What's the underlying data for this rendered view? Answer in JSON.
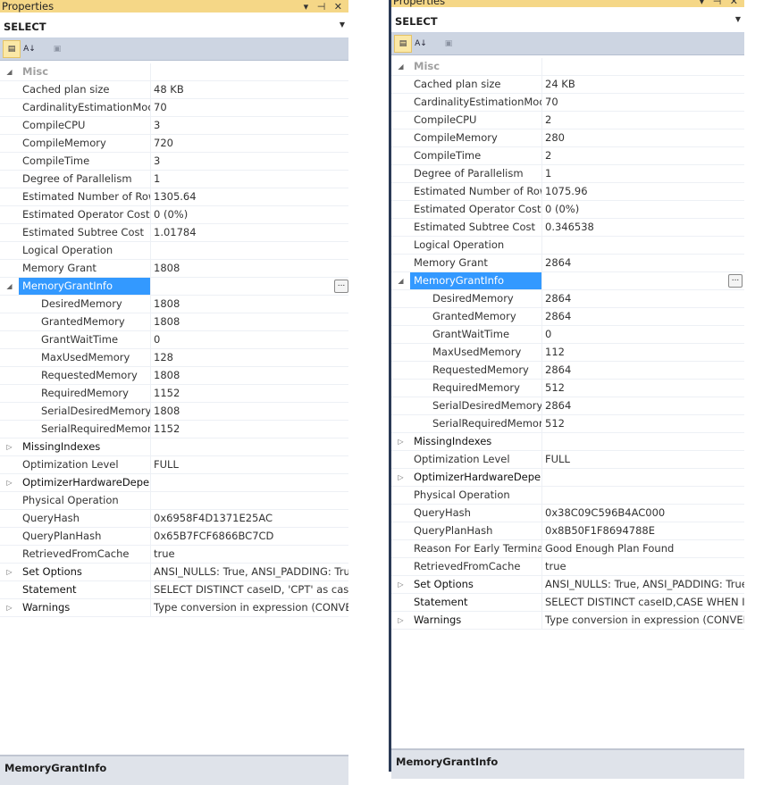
{
  "left": {
    "title": "Properties",
    "title_controls": "▾ ⊣ ✕",
    "selected_object": "SELECT",
    "rows": [
      {
        "name": "Misc",
        "value": "",
        "kind": "category",
        "exp": "◢"
      },
      {
        "name": "Cached plan size",
        "value": "48 KB"
      },
      {
        "name": "CardinalityEstimationModel",
        "value": "70"
      },
      {
        "name": "CompileCPU",
        "value": "3"
      },
      {
        "name": "CompileMemory",
        "value": "720"
      },
      {
        "name": "CompileTime",
        "value": "3"
      },
      {
        "name": "Degree of Parallelism",
        "value": "1"
      },
      {
        "name": "Estimated Number of Rows",
        "value": "1305.64"
      },
      {
        "name": "Estimated Operator Cost",
        "value": "0 (0%)"
      },
      {
        "name": "Estimated Subtree Cost",
        "value": "1.01784"
      },
      {
        "name": "Logical Operation",
        "value": ""
      },
      {
        "name": "Memory Grant",
        "value": "1808"
      },
      {
        "name": "MemoryGrantInfo",
        "value": "",
        "kind": "selected",
        "exp": "◢",
        "ellipsis": "..."
      },
      {
        "name": "DesiredMemory",
        "value": "1808",
        "kind": "sub"
      },
      {
        "name": "GrantedMemory",
        "value": "1808",
        "kind": "sub"
      },
      {
        "name": "GrantWaitTime",
        "value": "0",
        "kind": "sub"
      },
      {
        "name": "MaxUsedMemory",
        "value": "128",
        "kind": "sub"
      },
      {
        "name": "RequestedMemory",
        "value": "1808",
        "kind": "sub"
      },
      {
        "name": "RequiredMemory",
        "value": "1152",
        "kind": "sub"
      },
      {
        "name": "SerialDesiredMemory",
        "value": "1808",
        "kind": "sub"
      },
      {
        "name": "SerialRequiredMemory",
        "value": "1152",
        "kind": "sub"
      },
      {
        "name": "MissingIndexes",
        "value": "",
        "kind": "bold",
        "exp": "▷"
      },
      {
        "name": "Optimization Level",
        "value": "FULL"
      },
      {
        "name": "OptimizerHardwareDependentProperties",
        "value": "",
        "kind": "bold",
        "exp": "▷"
      },
      {
        "name": "Physical Operation",
        "value": ""
      },
      {
        "name": "QueryHash",
        "value": "0x6958F4D1371E25AC"
      },
      {
        "name": "QueryPlanHash",
        "value": "0x65B7FCF6866BC7CD"
      },
      {
        "name": "RetrievedFromCache",
        "value": "true"
      },
      {
        "name": "Set Options",
        "value": "ANSI_NULLS: True, ANSI_PADDING: True, ANSI_WARNINGS: True",
        "kind": "bold",
        "exp": "▷"
      },
      {
        "name": "Statement",
        "value": "SELECT DISTINCT caseID, 'CPT' as caseC,",
        "kind": "bold"
      },
      {
        "name": "Warnings",
        "value": "Type conversion in expression (CONVERT_IMPLICIT",
        "kind": "bold",
        "exp": "▷"
      }
    ],
    "status": "MemoryGrantInfo"
  },
  "right": {
    "title": "Properties",
    "title_controls": "▾ ⊣ ✕",
    "selected_object": "SELECT",
    "rows": [
      {
        "name": "Misc",
        "value": "",
        "kind": "category",
        "exp": "◢"
      },
      {
        "name": "Cached plan size",
        "value": "24 KB"
      },
      {
        "name": "CardinalityEstimationModel",
        "value": "70"
      },
      {
        "name": "CompileCPU",
        "value": "2"
      },
      {
        "name": "CompileMemory",
        "value": "280"
      },
      {
        "name": "CompileTime",
        "value": "2"
      },
      {
        "name": "Degree of Parallelism",
        "value": "1"
      },
      {
        "name": "Estimated Number of Rows",
        "value": "1075.96"
      },
      {
        "name": "Estimated Operator Cost",
        "value": "0 (0%)"
      },
      {
        "name": "Estimated Subtree Cost",
        "value": "0.346538"
      },
      {
        "name": "Logical Operation",
        "value": ""
      },
      {
        "name": "Memory Grant",
        "value": "2864"
      },
      {
        "name": "MemoryGrantInfo",
        "value": "",
        "kind": "selected",
        "exp": "◢",
        "ellipsis": "..."
      },
      {
        "name": "DesiredMemory",
        "value": "2864",
        "kind": "sub"
      },
      {
        "name": "GrantedMemory",
        "value": "2864",
        "kind": "sub"
      },
      {
        "name": "GrantWaitTime",
        "value": "0",
        "kind": "sub"
      },
      {
        "name": "MaxUsedMemory",
        "value": "112",
        "kind": "sub"
      },
      {
        "name": "RequestedMemory",
        "value": "2864",
        "kind": "sub"
      },
      {
        "name": "RequiredMemory",
        "value": "512",
        "kind": "sub"
      },
      {
        "name": "SerialDesiredMemory",
        "value": "2864",
        "kind": "sub"
      },
      {
        "name": "SerialRequiredMemory",
        "value": "512",
        "kind": "sub"
      },
      {
        "name": "MissingIndexes",
        "value": "",
        "kind": "bold",
        "exp": "▷"
      },
      {
        "name": "Optimization Level",
        "value": "FULL"
      },
      {
        "name": "OptimizerHardwareDependentProperties",
        "value": "",
        "kind": "bold",
        "exp": "▷"
      },
      {
        "name": "Physical Operation",
        "value": ""
      },
      {
        "name": "QueryHash",
        "value": "0x38C09C596B4AC000"
      },
      {
        "name": "QueryPlanHash",
        "value": "0x8B50F1F8694788E"
      },
      {
        "name": "Reason For Early Termination",
        "value": "Good Enough Plan Found"
      },
      {
        "name": "RetrievedFromCache",
        "value": "true"
      },
      {
        "name": "Set Options",
        "value": "ANSI_NULLS: True, ANSI_PADDING: True, ANSI_WARNINGS: True",
        "kind": "bold",
        "exp": "▷"
      },
      {
        "name": "Statement",
        "value": "SELECT DISTINCT caseID,CASE WHEN ISNULL",
        "kind": "bold"
      },
      {
        "name": "Warnings",
        "value": "Type conversion in expression (CONVERT_IMPLICIT",
        "kind": "bold",
        "exp": "▷"
      }
    ],
    "status": "MemoryGrantInfo"
  },
  "toolbar": {
    "categorized_icon": "categorized-icon",
    "alphabetical_icon": "alphabetical-icon",
    "property_pages_icon": "property-pages-icon",
    "alphabetical_glyph": "A↓"
  }
}
